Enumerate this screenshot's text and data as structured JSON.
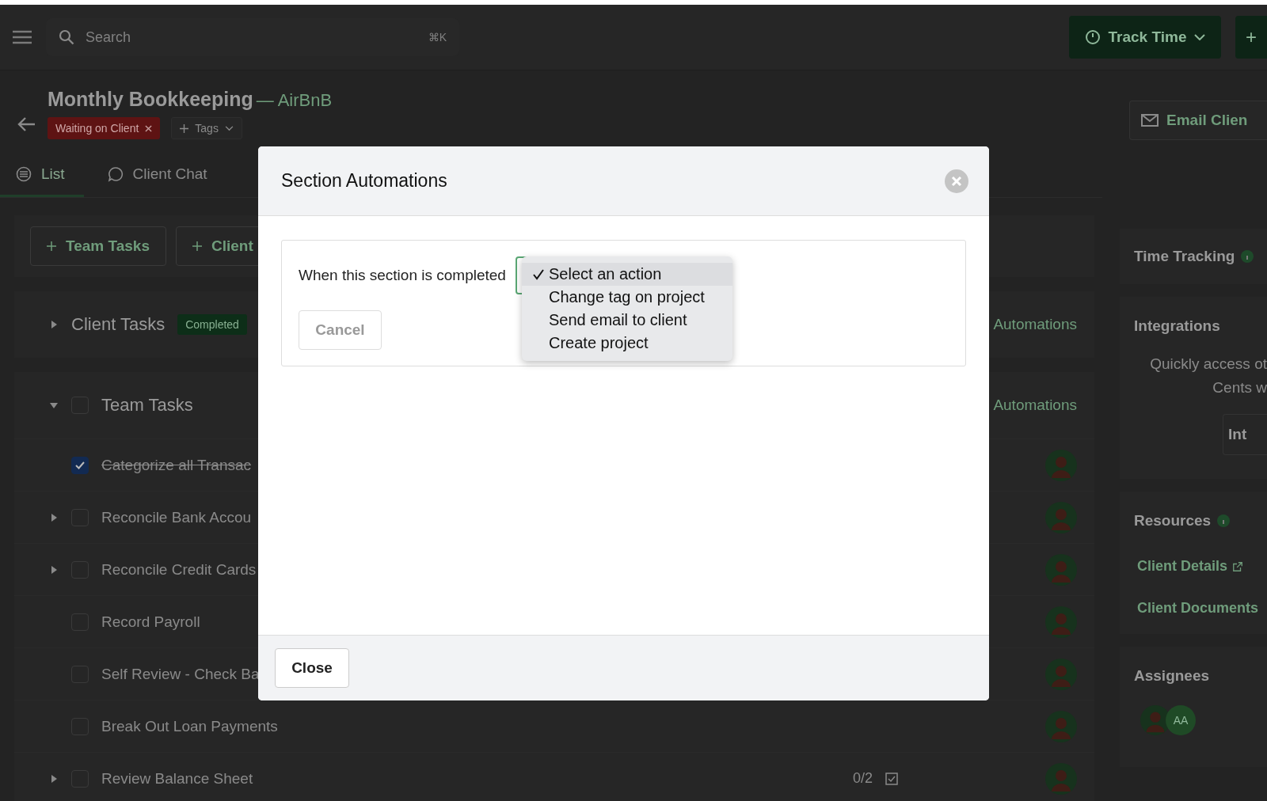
{
  "topbar": {
    "search": {
      "placeholder": "Search",
      "shortcut": "⌘K"
    },
    "track_time": "Track Time",
    "add_button": "+"
  },
  "project": {
    "title": "Monthly Bookkeeping",
    "client": "— AirBnB",
    "tags": [
      {
        "label": "Waiting on Client",
        "color": "#5e1313"
      }
    ],
    "add_tags": "Tags",
    "email_button": "Email Clien"
  },
  "tabs": [
    {
      "label": "List",
      "selected": true
    },
    {
      "label": "Client Chat",
      "selected": false
    }
  ],
  "add_buttons": [
    "Team Tasks",
    "Client"
  ],
  "sections": [
    {
      "title": "Client Tasks",
      "badge": "Completed",
      "expanded": false,
      "automations": "Automations"
    },
    {
      "title": "Team Tasks",
      "expanded": true,
      "checked": false,
      "automations": "Automations",
      "tasks": [
        {
          "name": "Categorize all Transac",
          "checked": true,
          "has_subtasks": false
        },
        {
          "name": "Reconcile Bank Accou",
          "checked": false,
          "has_subtasks": true
        },
        {
          "name": "Reconcile Credit Cards",
          "checked": false,
          "has_subtasks": true
        },
        {
          "name": "Record Payroll",
          "checked": false,
          "has_subtasks": false
        },
        {
          "name": "Self Review - Check Ba",
          "checked": false,
          "has_subtasks": false
        },
        {
          "name": "Break Out Loan Payments",
          "checked": false,
          "has_subtasks": false
        },
        {
          "name": "Review Balance Sheet",
          "checked": false,
          "has_subtasks": true,
          "progress": "0/2"
        }
      ]
    }
  ],
  "side": {
    "time_tracking": "Time Tracking",
    "integrations": {
      "title": "Integrations",
      "text_lines": [
        "Quickly access ot",
        "Cents w"
      ],
      "button": "Int"
    },
    "resources": {
      "title": "Resources",
      "links": [
        "Client Details",
        "Client Documents"
      ]
    },
    "assignees": {
      "title": "Assignees",
      "people": [
        {
          "kind": "photo"
        },
        {
          "kind": "initials",
          "initials": "AA"
        }
      ]
    }
  },
  "modal": {
    "title": "Section Automations",
    "trigger_label": "When this section is completed",
    "options": [
      {
        "label": "Select an action",
        "selected": true
      },
      {
        "label": "Change tag on project",
        "selected": false
      },
      {
        "label": "Send email to client",
        "selected": false
      },
      {
        "label": "Create project",
        "selected": false
      }
    ],
    "cancel": {
      "label": "Cancel",
      "disabled": true
    },
    "close": "Close"
  }
}
